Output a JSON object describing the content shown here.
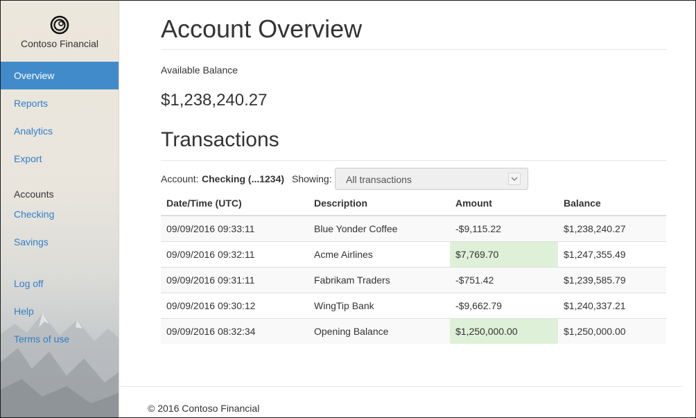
{
  "brand": {
    "name": "Contoso Financial",
    "logo_icon": "ring-logo-icon"
  },
  "sidebar": {
    "items": [
      {
        "label": "Overview",
        "active": true
      },
      {
        "label": "Reports"
      },
      {
        "label": "Analytics"
      },
      {
        "label": "Export"
      }
    ],
    "accounts_heading": "Accounts",
    "accounts": [
      {
        "label": "Checking"
      },
      {
        "label": "Savings"
      }
    ],
    "footer_links": [
      {
        "label": "Log off"
      },
      {
        "label": "Help"
      },
      {
        "label": "Terms of use"
      }
    ]
  },
  "main": {
    "title": "Account Overview",
    "balance_label": "Available Balance",
    "balance_value": "$1,238,240.27",
    "transactions_title": "Transactions",
    "filter": {
      "account_label": "Account:",
      "account_value": "Checking (...1234)",
      "showing_label": "Showing:",
      "select_value": "All transactions"
    },
    "table": {
      "headers": [
        "Date/Time (UTC)",
        "Description",
        "Amount",
        "Balance"
      ],
      "rows": [
        {
          "datetime": "09/09/2016 09:33:11",
          "description": "Blue Yonder Coffee",
          "amount": "-$9,115.22",
          "balance": "$1,238,240.27",
          "credit": false
        },
        {
          "datetime": "09/09/2016 09:32:11",
          "description": "Acme Airlines",
          "amount": "$7,769.70",
          "balance": "$1,247,355.49",
          "credit": true
        },
        {
          "datetime": "09/09/2016 09:31:11",
          "description": "Fabrikam Traders",
          "amount": "-$751.42",
          "balance": "$1,239,585.79",
          "credit": false
        },
        {
          "datetime": "09/09/2016 09:30:12",
          "description": "WingTip Bank",
          "amount": "-$9,662.79",
          "balance": "$1,240,337.21",
          "credit": false
        },
        {
          "datetime": "09/09/2016 08:32:34",
          "description": "Opening Balance",
          "amount": "$1,250,000.00",
          "balance": "$1,250,000.00",
          "credit": true
        }
      ]
    }
  },
  "footer": {
    "text": "© 2016 Contoso Financial"
  },
  "colors": {
    "accent": "#428bca",
    "link": "#2f7fc9",
    "credit_bg": "#dff0d8",
    "text": "#333333"
  }
}
